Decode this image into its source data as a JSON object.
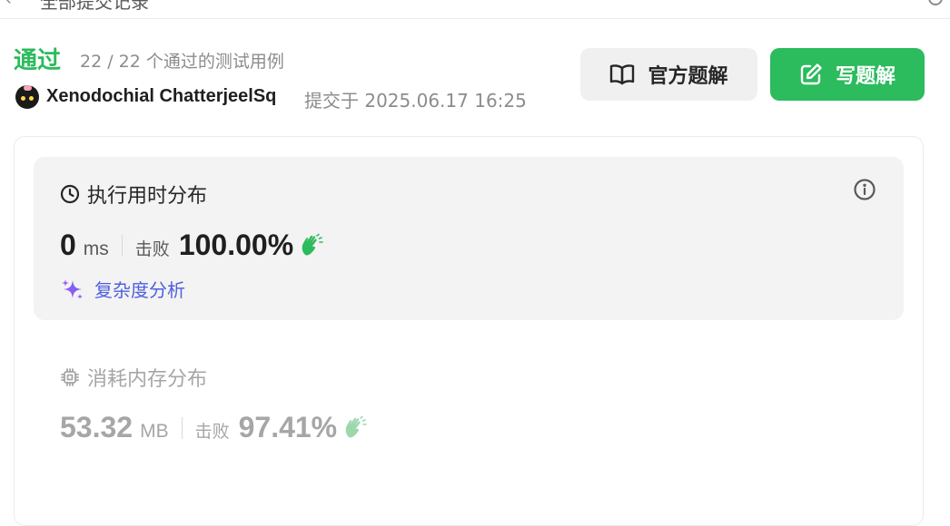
{
  "topbar": {
    "back_glyph": "‹",
    "crumb": "全部提交记录"
  },
  "status": {
    "label": "通过",
    "color": "#2cbb5d",
    "testcases": "22 / 22 个通过的测试用例"
  },
  "submitter": {
    "username": "Xenodochial ChatterjeelSq",
    "submitted_at": "提交于 2025.06.17 16:25"
  },
  "actions": {
    "editorial_label": "官方题解",
    "write_solution_label": "写题解"
  },
  "runtime": {
    "title": "执行用时分布",
    "value": "0",
    "unit": "ms",
    "beats_label": "击败",
    "beats_pct": "100.00%",
    "complexity_label": "复杂度分析"
  },
  "memory": {
    "title": "消耗内存分布",
    "value": "53.32",
    "unit": "MB",
    "beats_label": "击败",
    "beats_pct": "97.41%"
  },
  "icons": {
    "book": "book-icon",
    "edit": "edit-icon",
    "clock": "clock-icon",
    "info": "info-icon",
    "sparkle": "sparkle-icon",
    "chip": "chip-icon",
    "clap": "clap-icon"
  },
  "colors": {
    "accent_green": "#2cbb5d",
    "muted_text": "#8c8c8c",
    "complexity": "#5b6ee8"
  }
}
